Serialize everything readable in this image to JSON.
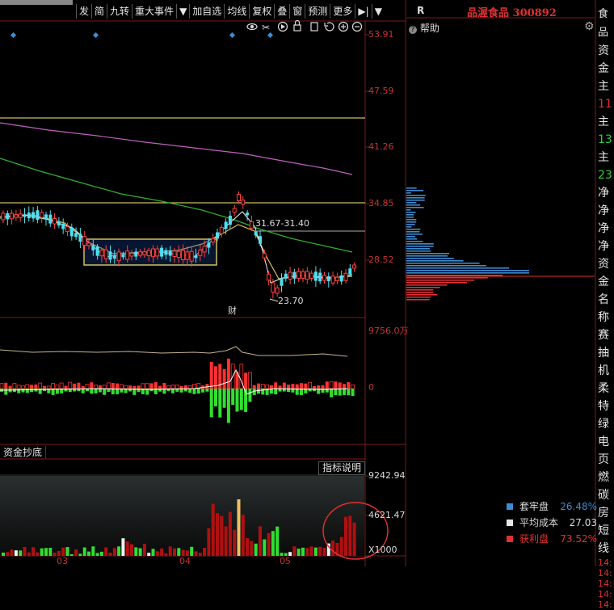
{
  "toolbar": {
    "items": [
      "发",
      "简",
      "九转",
      "重大事件",
      "▼",
      "加自选",
      "均线",
      "复权",
      "叠",
      "窗",
      "预测",
      "更多",
      "▶|",
      "▼"
    ]
  },
  "main_chart": {
    "y_ticks": [
      "53.91",
      "47.59",
      "41.26",
      "34.85",
      "28.52"
    ],
    "range_label": "31.67-31.40",
    "low_label": "23.70",
    "fin_marker": "财"
  },
  "volume_panel": {
    "y_ticks": [
      "9756.0万",
      "0"
    ]
  },
  "indicator_panel": {
    "tab_label": "资金抄底",
    "explain_button": "指标说明",
    "y_ticks": [
      "9242.94",
      "4621.47",
      "X1000"
    ],
    "x_ticks": [
      "03",
      "04",
      "05"
    ]
  },
  "chip_panel": {
    "r_label": "R",
    "stock_title": "品渥食品 300892",
    "help_label": "帮助",
    "legend": [
      {
        "label": "套牢盘",
        "value": "26.48%",
        "color": "#3c8cd2"
      },
      {
        "label": "平均成本",
        "value": "27.03",
        "color": "#e6e6e6"
      },
      {
        "label": "获利盘",
        "value": "73.52%",
        "color": "#e03030"
      }
    ]
  },
  "right_panel": {
    "top_label": "食品",
    "rows": [
      {
        "text": "资金",
        "color": "#e6e6e6"
      },
      {
        "text": "主",
        "color": "#e6e6e6"
      },
      {
        "text": "11",
        "color": "#e03030"
      },
      {
        "text": "主",
        "color": "#e6e6e6"
      },
      {
        "text": "13",
        "color": "#30d030"
      },
      {
        "text": "主",
        "color": "#e6e6e6"
      },
      {
        "text": "23",
        "color": "#30d030"
      },
      {
        "text": "净",
        "color": "#e6e6e6"
      },
      {
        "text": "净",
        "color": "#e6e6e6"
      },
      {
        "text": "净",
        "color": "#e6e6e6"
      },
      {
        "text": "净",
        "color": "#e6e6e6"
      },
      {
        "text": "资金",
        "color": "#e6e6e6"
      },
      {
        "text": "名称",
        "color": "#e6e6e6"
      },
      {
        "text": "赛",
        "color": "#e6e6e6"
      },
      {
        "text": "抽",
        "color": "#e6e6e6"
      },
      {
        "text": "机",
        "color": "#e6e6e6"
      },
      {
        "text": "柔",
        "color": "#e6e6e6"
      },
      {
        "text": "特",
        "color": "#e6e6e6"
      },
      {
        "text": "绿",
        "color": "#e6e6e6"
      },
      {
        "text": "电",
        "color": "#e6e6e6"
      },
      {
        "text": "页",
        "color": "#e6e6e6"
      },
      {
        "text": "燃",
        "color": "#e6e6e6"
      },
      {
        "text": "碳",
        "color": "#e6e6e6"
      },
      {
        "text": "房",
        "color": "#e6e6e6"
      },
      {
        "text": "短线",
        "color": "#e6e6e6"
      },
      {
        "text": "14:",
        "color": "#e03030"
      },
      {
        "text": "14:",
        "color": "#e03030"
      },
      {
        "text": "14:",
        "color": "#e03030"
      },
      {
        "text": "14:",
        "color": "#e03030"
      },
      {
        "text": "14:",
        "color": "#e03030"
      }
    ]
  }
}
